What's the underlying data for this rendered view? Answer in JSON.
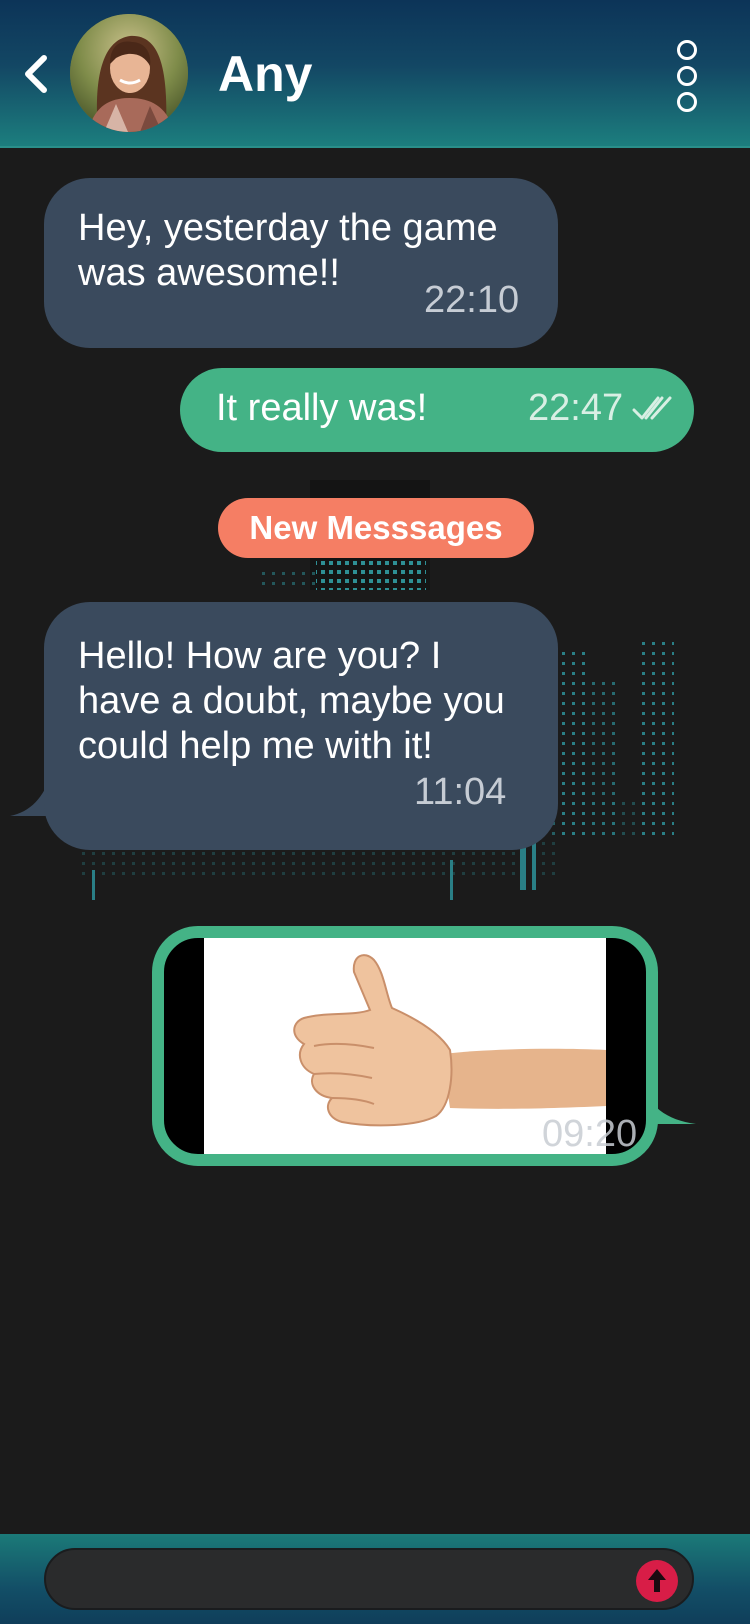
{
  "header": {
    "contact_name": "Any",
    "back_icon": "chevron-left-icon",
    "menu_icon": "more-vertical-icon"
  },
  "messages": [
    {
      "direction": "incoming",
      "text": "Hey, yesterday the game was awesome!!",
      "time": "22:10"
    },
    {
      "direction": "outgoing",
      "text": "It really was!",
      "time": "22:47",
      "status_icon": "double-check-icon"
    },
    {
      "direction": "incoming",
      "text": "Hello! How are you? I have a doubt, maybe you could help me with it!",
      "time": "11:04"
    },
    {
      "direction": "outgoing",
      "type": "image",
      "image_icon": "thumbs-up-photo",
      "time": "09:20"
    }
  ],
  "divider": {
    "label": "New Messsages"
  },
  "composer": {
    "value": "",
    "placeholder": "",
    "send_icon": "arrow-up-icon"
  },
  "colors": {
    "incoming_bubble": "#3a4a5d",
    "outgoing_bubble": "#44b386",
    "new_messages_pill": "#f57e64",
    "send_button": "#d81d47",
    "background": "#1b1b1b"
  }
}
